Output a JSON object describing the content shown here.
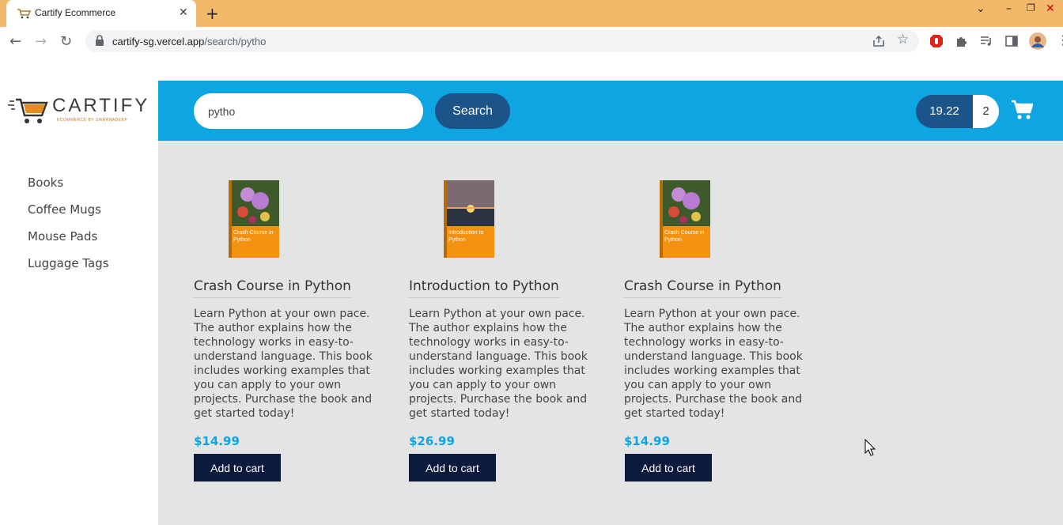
{
  "browser": {
    "tab_title": "Cartify Ecommerce",
    "url_host": "cartify-sg.vercel.app",
    "url_path": "/search/pytho"
  },
  "brand": {
    "logo_text": "CARTIFY",
    "logo_tagline": "ECOMMERCE BY SWARNADEEP",
    "accent": "#0ea5e2",
    "dark_blue": "#1a5489",
    "button_navy": "#0b1a3d"
  },
  "header": {
    "search_value": "pytho",
    "search_button": "Search",
    "cart_total": "19.22",
    "cart_count": "2"
  },
  "sidebar": {
    "items": [
      {
        "label": "Books"
      },
      {
        "label": "Coffee Mugs"
      },
      {
        "label": "Mouse Pads"
      },
      {
        "label": "Luggage Tags"
      }
    ]
  },
  "products": [
    {
      "title": "Crash Course in Python",
      "cover_text": "Crash Course in Python",
      "cover": "flowers",
      "description": "Learn Python at your own pace. The author explains how the technology works in easy-to-understand language. This book includes working examples that you can apply to your own projects. Purchase the book and get started today!",
      "price": "$14.99",
      "button": "Add to cart"
    },
    {
      "title": "Introduction to Python",
      "cover_text": "Introduction to Python",
      "cover": "sunset",
      "description": "Learn Python at your own pace. The author explains how the technology works in easy-to-understand language. This book includes working examples that you can apply to your own projects. Purchase the book and get started today!",
      "price": "$26.99",
      "button": "Add to cart"
    },
    {
      "title": "Crash Course in Python",
      "cover_text": "Crash Course in Python",
      "cover": "flowers",
      "description": "Learn Python at your own pace. The author explains how the technology works in easy-to-understand language. This book includes working examples that you can apply to your own projects. Purchase the book and get started today!",
      "price": "$14.99",
      "button": "Add to cart"
    }
  ]
}
